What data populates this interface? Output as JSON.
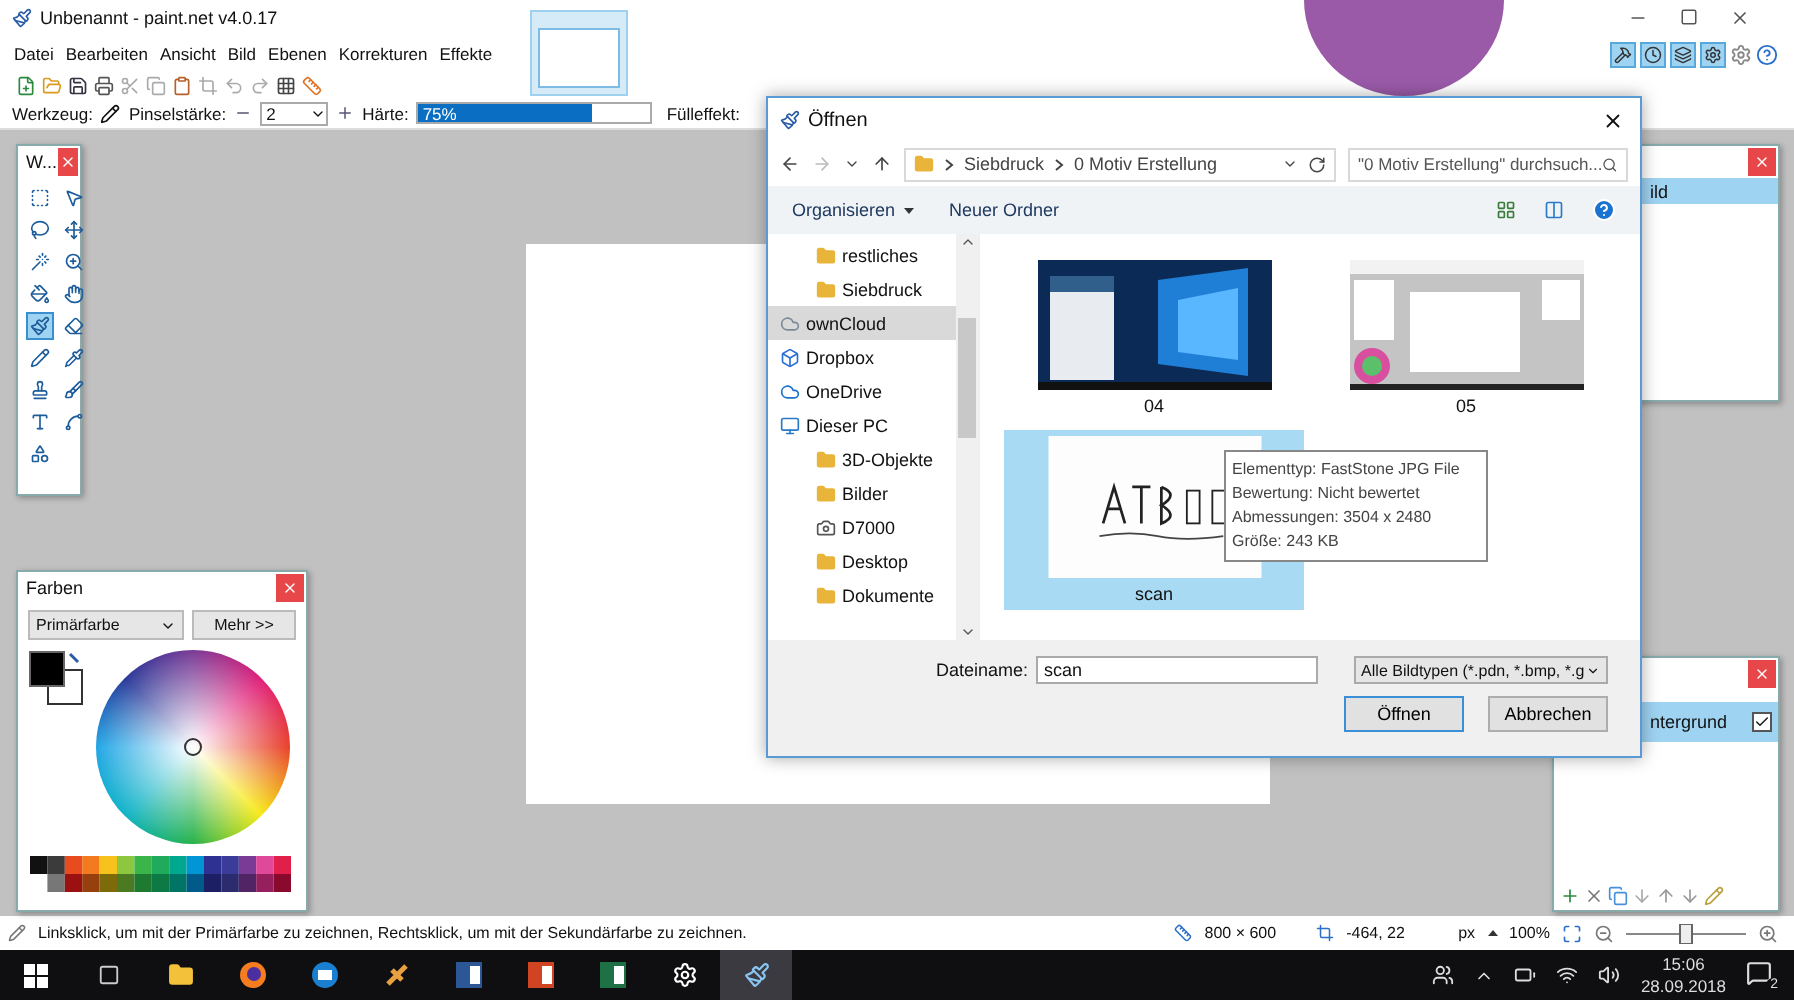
{
  "app": {
    "title": "Unbenannt - paint.net v4.0.17"
  },
  "menu": [
    "Datei",
    "Bearbeiten",
    "Ansicht",
    "Bild",
    "Ebenen",
    "Korrekturen",
    "Effekte"
  ],
  "window_toggles": [
    {
      "kind": "tools",
      "on": true
    },
    {
      "kind": "history",
      "on": true
    },
    {
      "kind": "layers",
      "on": true
    },
    {
      "kind": "colors",
      "on": true
    }
  ],
  "tool_options": {
    "tool_label": "Werkzeug:",
    "brush_label": "Pinselstärke:",
    "brush_value": "2",
    "hardness_label": "Härte:",
    "hardness": {
      "reading": "75%",
      "level": 0.75
    },
    "fill_label": "Fülleffekt:"
  },
  "tools_window": {
    "title": "W...",
    "tools": [
      {
        "kind": "rect-select",
        "selected": false
      },
      {
        "kind": "move-selection",
        "selected": false
      },
      {
        "kind": "lasso",
        "selected": false
      },
      {
        "kind": "move",
        "selected": false
      },
      {
        "kind": "wand",
        "selected": false
      },
      {
        "kind": "zoom",
        "selected": false
      },
      {
        "kind": "bucket",
        "selected": false
      },
      {
        "kind": "hand",
        "selected": false
      },
      {
        "kind": "brush",
        "selected": true
      },
      {
        "kind": "eraser",
        "selected": false
      },
      {
        "kind": "pencil",
        "selected": false
      },
      {
        "kind": "pipette",
        "selected": false
      },
      {
        "kind": "stamp",
        "selected": false
      },
      {
        "kind": "recolor",
        "selected": false
      },
      {
        "kind": "text",
        "selected": false
      },
      {
        "kind": "curve",
        "selected": false
      },
      {
        "kind": "shapes",
        "selected": false
      }
    ]
  },
  "colors_window": {
    "title": "Farben",
    "mode": "Primärfarbe",
    "more": "Mehr >>"
  },
  "history_window": {
    "items": [
      {
        "label": "ild",
        "selected": true
      }
    ]
  },
  "layers_window": {
    "layers": [
      {
        "name": "ntergrund",
        "visible": true,
        "selected": true
      }
    ]
  },
  "dialog": {
    "title": "Öffnen",
    "path": [
      "Siebdruck",
      "0 Motiv Erstellung"
    ],
    "search_placeholder": "\"0 Motiv Erstellung\" durchsuch...",
    "organize": "Organisieren",
    "new_folder": "Neuer Ordner",
    "nav": [
      {
        "label": "restliches",
        "kind": "folder",
        "selected": false
      },
      {
        "label": "Siebdruck",
        "kind": "folder",
        "selected": false
      },
      {
        "label": "ownCloud",
        "kind": "cloud",
        "selected": true
      },
      {
        "label": "Dropbox",
        "kind": "dropbox",
        "selected": false
      },
      {
        "label": "OneDrive",
        "kind": "onedrive",
        "selected": false
      },
      {
        "label": "Dieser PC",
        "kind": "pc",
        "selected": false,
        "children": [
          {
            "label": "3D-Objekte",
            "kind": "folder",
            "selected": false
          },
          {
            "label": "Bilder",
            "kind": "folder",
            "selected": false
          },
          {
            "label": "D7000",
            "kind": "camera",
            "selected": false
          },
          {
            "label": "Desktop",
            "kind": "folder",
            "selected": false
          },
          {
            "label": "Dokumente",
            "kind": "folder",
            "selected": false
          }
        ]
      }
    ],
    "files": [
      {
        "name": "04",
        "kind": "desktop",
        "selected": false
      },
      {
        "name": "05",
        "kind": "app",
        "selected": false
      },
      {
        "name": "scan",
        "kind": "scan",
        "selected": true
      }
    ],
    "filename_label": "Dateiname:",
    "filename": "scan",
    "filetype": "Alle Bildtypen (*.pdn, *.bmp, *.g",
    "buttons": [
      "Öffnen",
      "Abbrechen"
    ]
  },
  "tooltip": {
    "lines": [
      "Elementtyp: FastStone JPG File",
      "Bewertung: Nicht bewertet",
      "Abmessungen: 3504 x 2480",
      "Größe: 243 KB"
    ]
  },
  "status_bar": {
    "hint": "Linksklick, um mit der Primärfarbe zu zeichnen, Rechtsklick, um mit der Sekundärfarbe zu zeichnen.",
    "size": "800 × 600",
    "cursor": "-464, 22",
    "unit": "px",
    "zoom": "100%",
    "zoom_slider": {
      "level": 0.5
    }
  },
  "taskbar": {
    "time": "15:06",
    "date": "28.09.2018",
    "notifications": "2"
  }
}
